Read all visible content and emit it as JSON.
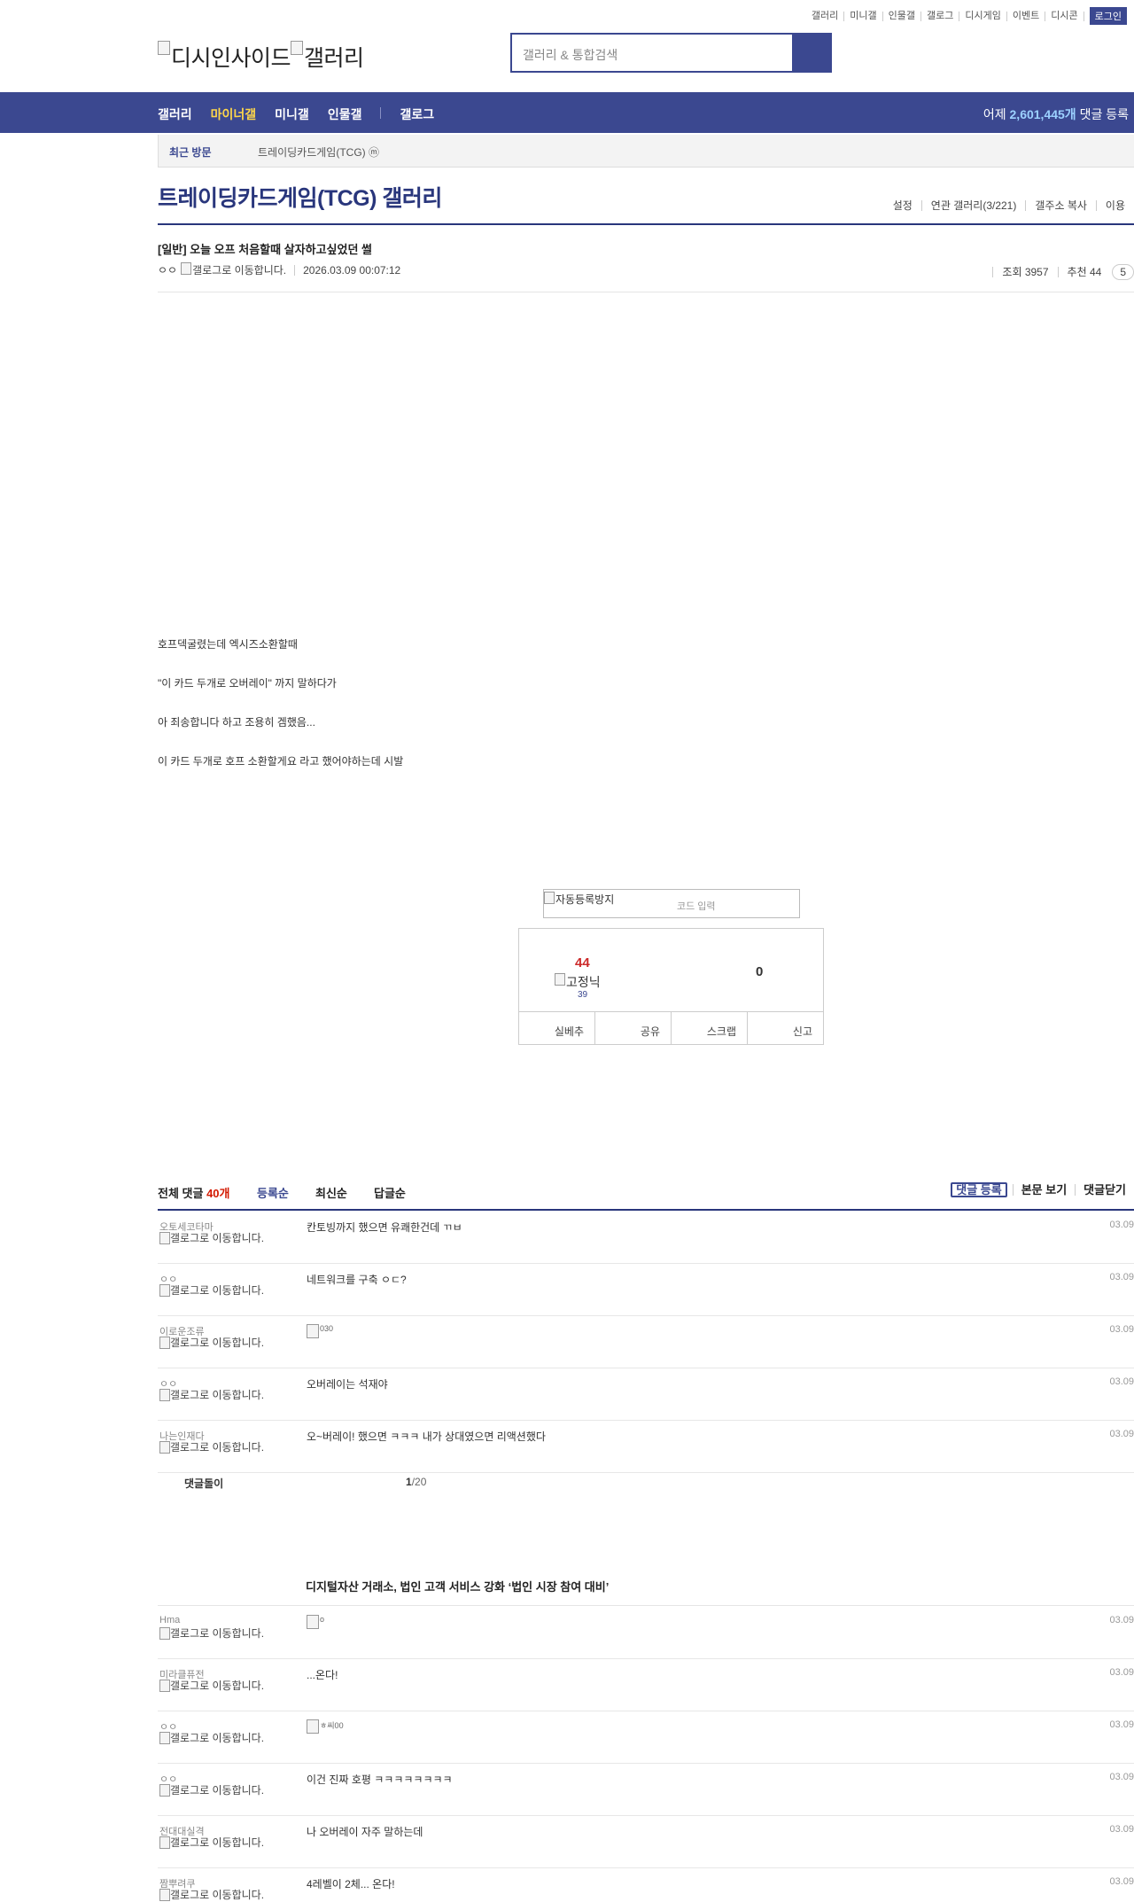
{
  "top_links": [
    "갤러리",
    "미니갤",
    "인물갤",
    "갤로그",
    "디시게임",
    "이벤트",
    "디시콘"
  ],
  "login_label": "로그인",
  "logo": {
    "alt1": "디시인사이드",
    "alt2": "갤러리"
  },
  "search": {
    "placeholder": "갤러리 & 통합검색"
  },
  "gnb": {
    "items": [
      "갤러리",
      "마이너갤",
      "미니갤",
      "인물갤",
      "갤로그"
    ],
    "active": "마이너갤",
    "stat_prefix": "어제",
    "stat_count": "2,601,445개",
    "stat_suffix": "댓글 등록"
  },
  "recent": {
    "label": "최근 방문",
    "item": "트레이딩카드게임(TCG) ⓜ"
  },
  "gallery": {
    "title": "트레이딩카드게임(TCG) 갤러리",
    "menu": [
      "설정",
      "연관 갤러리(3/221)",
      "갤주소 복사",
      "이용"
    ]
  },
  "post": {
    "title": "[일반] 오늘 오프 처음할때 살자하고싶었던 썰",
    "author": "ㅇㅇ",
    "author_img_alt": "갤로그로 이동합니다.",
    "date": "2026.03.09 00:07:12",
    "views": "조회 3957",
    "recommend": "추천 44",
    "comment_badge": "5",
    "body": [
      "호프덱굴렸는데 엑시즈소환할때",
      "\"이 카드 두개로 오버레이\" 까지 말하다가",
      "아 죄송합니다 하고 조용히 겜했음...",
      "이 카드 두개로 호프 소환할게요 라고 했어야하는데 시발"
    ]
  },
  "captcha": {
    "img_alt": "자동등록방지",
    "placeholder": "코드 입력"
  },
  "recommend_box": {
    "up": "44",
    "fixed_alt": "고정닉",
    "fixed_count": "39",
    "down": "0",
    "buttons": [
      "실베추",
      "공유",
      "스크랩",
      "신고"
    ]
  },
  "comments_header": {
    "total_label": "전체 댓글",
    "total_count": "40개",
    "sort": [
      "등록순",
      "최신순",
      "답글순"
    ],
    "right": [
      "댓글 등록",
      "본문 보기",
      "댓글닫기"
    ]
  },
  "gallog_alt": "갤로그로 이동합니다.",
  "comments": [
    {
      "nick": "오토세코타마",
      "text": "칸토빙까지 했으면 유쾌한건데 ㄲㅂ",
      "date": "03.09"
    },
    {
      "nick": "ㅇㅇ",
      "text": "네트워크를 구축 ㅇㄷ?",
      "date": "03.09"
    },
    {
      "nick": "이로운조류",
      "text": "",
      "img_alt": "030",
      "date": "03.09"
    },
    {
      "nick": "ㅇㅇ",
      "text": "오버레이는 석재야",
      "date": "03.09"
    },
    {
      "nick": "나는인재다",
      "text": "오~버레이! 했으면 ㅋㅋㅋ 내가 상대였으면 리액션했다",
      "date": "03.09"
    }
  ],
  "reply_paging": {
    "label": "댓글돌이",
    "current": "1",
    "total": "/20"
  },
  "news_title": "디지털자산 거래소, 법인 고객 서비스 강화 ‘법인 시장 참여 대비’",
  "comments2": [
    {
      "nick": "Hma",
      "text": "",
      "img_alt": "o",
      "date": "03.09"
    },
    {
      "nick": "미라클퓨전",
      "text": "...온다!",
      "date": "03.09"
    },
    {
      "nick": "ㅇㅇ",
      "text": "",
      "img_alt": "ㅎ씨00",
      "date": "03.09"
    },
    {
      "nick": "ㅇㅇ",
      "text": "이건 진짜 호평 ㅋㅋㅋㅋㅋㅋㅋㅋ",
      "date": "03.09"
    },
    {
      "nick": "전대대실격",
      "text": "나 오버레이 자주 말하는데",
      "date": "03.09"
    },
    {
      "nick": "짬뿌려쿠",
      "text": "4레벨이 2체... 온다!",
      "date": "03.09"
    }
  ]
}
